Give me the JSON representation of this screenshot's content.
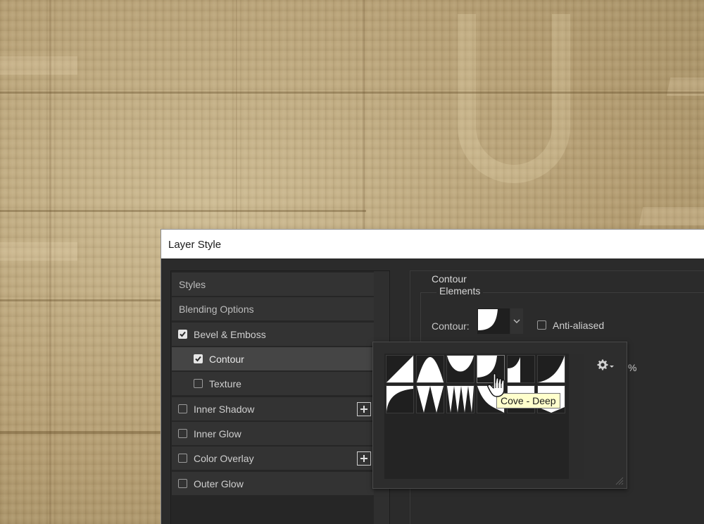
{
  "dialog": {
    "title": "Layer Style"
  },
  "styles_list": {
    "items": [
      {
        "label": "Styles",
        "type": "header"
      },
      {
        "label": "Blending Options",
        "type": "header"
      },
      {
        "label": "Bevel & Emboss",
        "checked": true,
        "active": false
      },
      {
        "label": "Contour",
        "checked": true,
        "active": true,
        "sub": true
      },
      {
        "label": "Texture",
        "checked": false,
        "sub": true
      },
      {
        "label": "Inner Shadow",
        "checked": false,
        "has_plus": true
      },
      {
        "label": "Inner Glow",
        "checked": false
      },
      {
        "label": "Color Overlay",
        "checked": false,
        "has_plus": true
      },
      {
        "label": "Outer Glow",
        "checked": false
      }
    ]
  },
  "contour_panel": {
    "section_title": "Contour",
    "group_title": "Elements",
    "contour_label": "Contour:",
    "anti_aliased_label": "Anti-aliased",
    "anti_aliased_checked": false,
    "range_unit": "%"
  },
  "contour_presets": {
    "tooltip": "Cove - Deep",
    "hovered_icon": "hand-pointer-icon",
    "menu_icon": "gear-icon"
  },
  "colors": {
    "dialog_bg": "#2b2b2b",
    "titlebar_bg": "#ffffff",
    "active_item_bg": "#454545",
    "tooltip_bg": "#ffffcc"
  }
}
